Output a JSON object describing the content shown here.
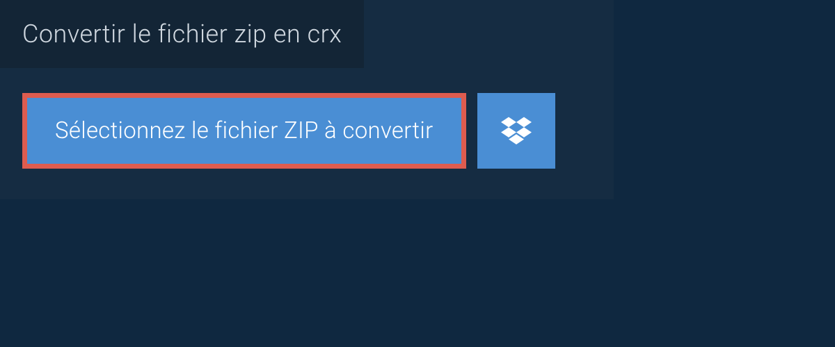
{
  "header": {
    "title": "Convertir le fichier zip en crx"
  },
  "buttons": {
    "select_file_label": "Sélectionnez le fichier ZIP à convertir",
    "dropbox_icon": "dropbox-icon"
  },
  "colors": {
    "background": "#0f2840",
    "panel": "#152c42",
    "header_tab": "#132536",
    "button_primary": "#4a8ed4",
    "highlight_border": "#de5c4f",
    "text_light": "#d0d8e0",
    "text_white": "#ffffff"
  }
}
